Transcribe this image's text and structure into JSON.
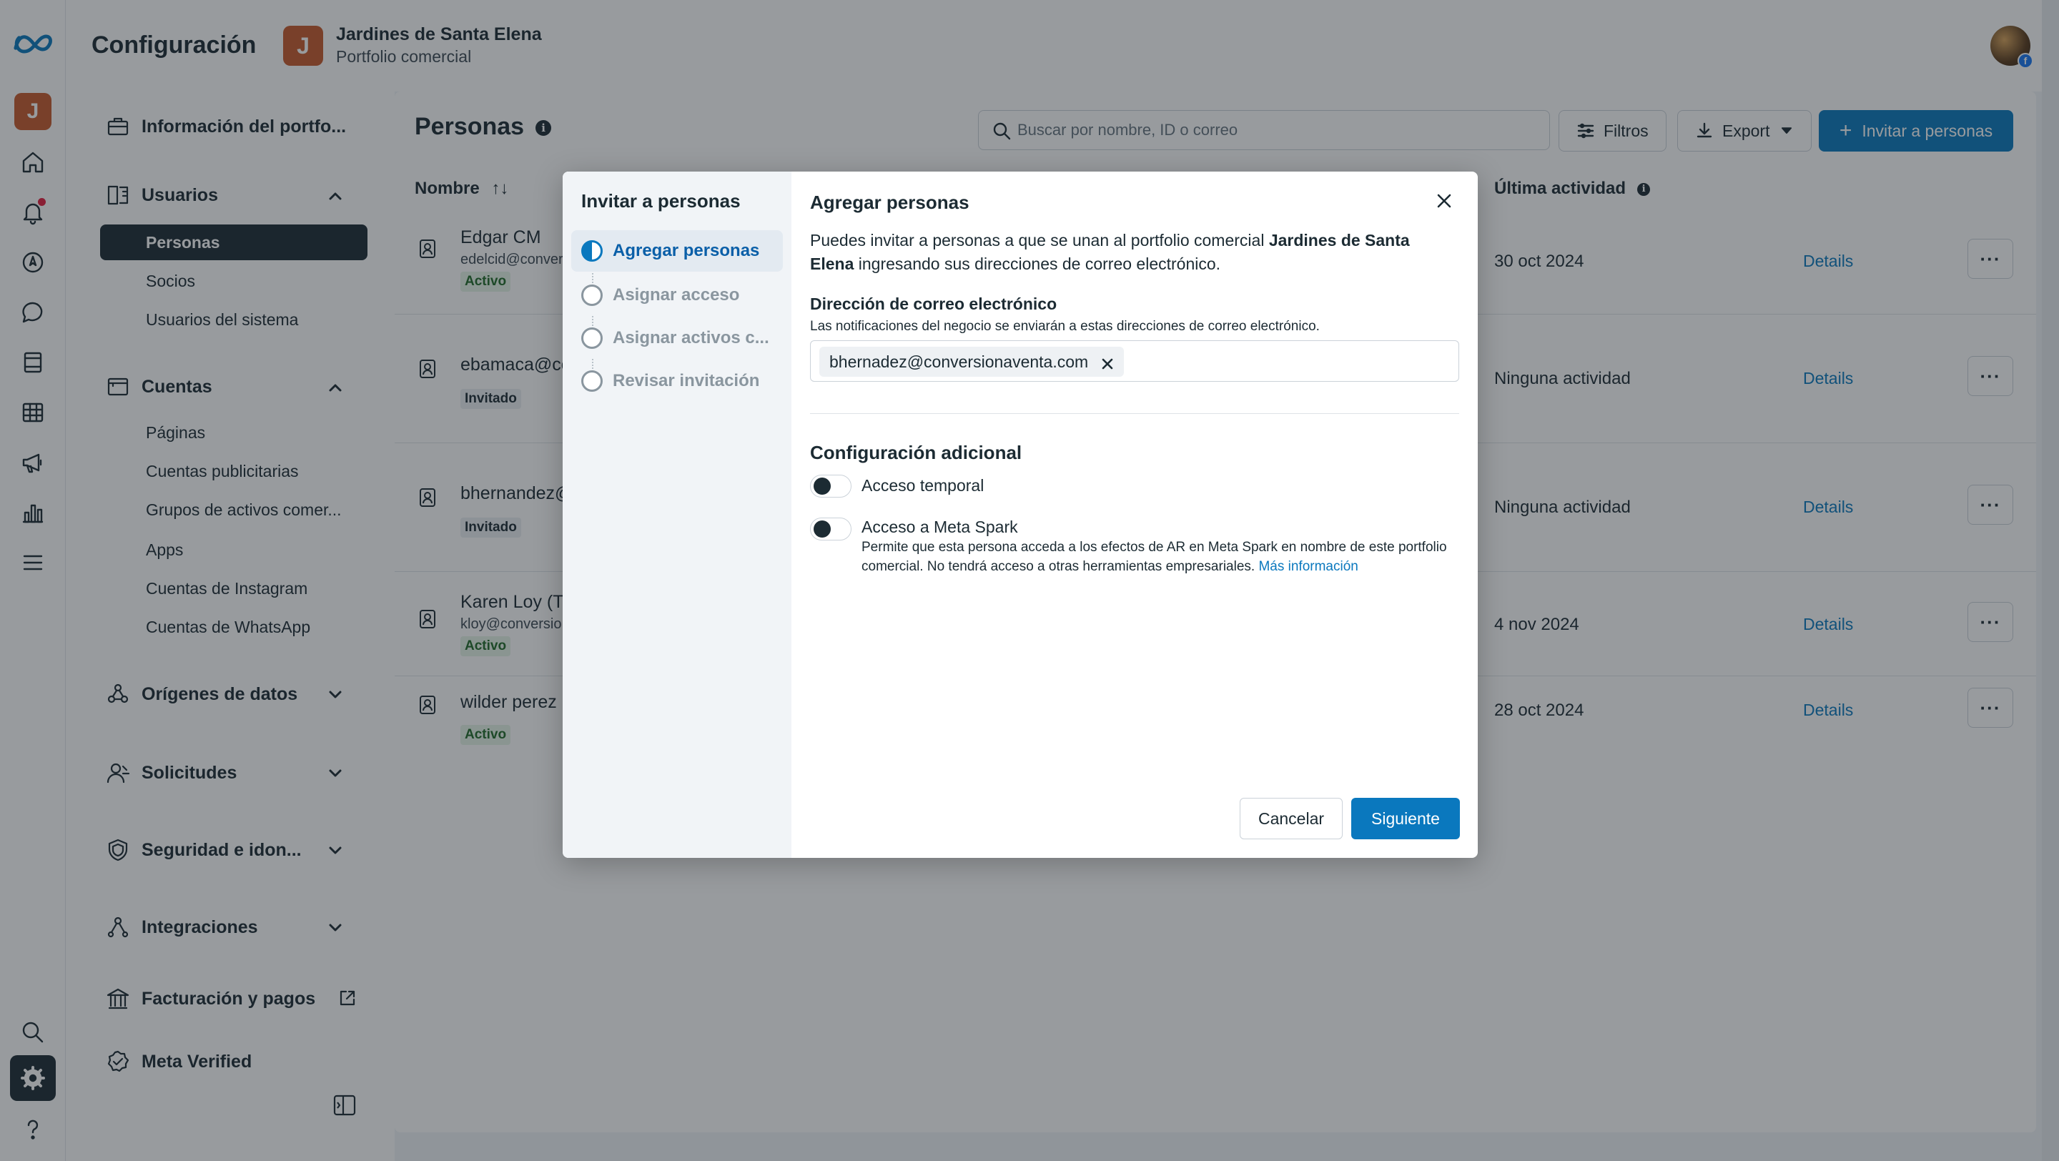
{
  "header": {
    "title": "Configuración",
    "business_initial": "J",
    "business_name": "Jardines de Santa Elena",
    "business_type": "Portfolio comercial"
  },
  "rail": {
    "avatar_initial": "J",
    "icons": [
      "meta-logo-icon",
      "home-icon",
      "bell-icon",
      "compass-icon",
      "chat-icon",
      "pages-icon",
      "table-icon",
      "megaphone-icon",
      "bar-chart-icon",
      "menu-icon",
      "search-icon",
      "gear-icon",
      "help-icon"
    ]
  },
  "sidebar": {
    "portfolio_info": "Información del portfo...",
    "users": {
      "label": "Usuarios",
      "items": [
        "Personas",
        "Socios",
        "Usuarios del sistema"
      ]
    },
    "accounts": {
      "label": "Cuentas",
      "items": [
        "Páginas",
        "Cuentas publicitarias",
        "Grupos de activos comer...",
        "Apps",
        "Cuentas de Instagram",
        "Cuentas de WhatsApp"
      ]
    },
    "data_sources": "Orígenes de datos",
    "requests": "Solicitudes",
    "security": "Seguridad e idon...",
    "integrations": "Integraciones",
    "billing": "Facturación y pagos",
    "meta_verified": "Meta Verified"
  },
  "main": {
    "title": "Personas",
    "search_placeholder": "Buscar por nombre, ID o correo",
    "filters_label": "Filtros",
    "export_label": "Export",
    "invite_label": "Invitar a personas",
    "col_name": "Nombre",
    "col_activity": "Última actividad",
    "rows": [
      {
        "name": "Edgar CM",
        "email": "edelcid@conver",
        "status": "Activo",
        "activity": "30 oct 2024",
        "details": "Details"
      },
      {
        "name": "ebamaca@cc",
        "email": "",
        "status": "Invitado",
        "activity": "Ninguna actividad",
        "details": "Details"
      },
      {
        "name": "bhernandez@",
        "email": "",
        "status": "Invitado",
        "activity": "Ninguna actividad",
        "details": "Details"
      },
      {
        "name": "Karen Loy (T",
        "email": "kloy@conversio",
        "status": "Activo",
        "activity": "4 nov 2024",
        "details": "Details"
      },
      {
        "name": "wilder perez",
        "email": "",
        "status": "Activo",
        "activity": "28 oct 2024",
        "details": "Details"
      }
    ],
    "more_label": "···"
  },
  "modal": {
    "steps_title": "Invitar a personas",
    "steps": [
      "Agregar personas",
      "Asignar acceso",
      "Asignar activos c...",
      "Revisar invitación"
    ],
    "title": "Agregar personas",
    "desc_before": "Puedes invitar a personas a que se unan al portfolio comercial ",
    "desc_bold": "Jardines de Santa Elena",
    "desc_after": " ingresando sus direcciones de correo electrónico.",
    "email_label": "Dirección de correo electrónico",
    "email_help": "Las notificaciones del negocio se enviarán a estas direcciones de correo electrónico.",
    "email_chip": "bhernadez@conversionaventa.com",
    "additional_title": "Configuración adicional",
    "temp_access_label": "Acceso temporal",
    "spark_label": "Acceso a Meta Spark",
    "spark_desc": "Permite que esta persona acceda a los efectos de AR en Meta Spark en nombre de este portfolio comercial. No tendrá acceso a otras herramientas empresariales. ",
    "spark_more": "Más información",
    "cancel_label": "Cancelar",
    "next_label": "Siguiente"
  },
  "colors": {
    "accent": "#0a78be",
    "brand_orange": "#c65a2c",
    "active_badge_bg": "#e6f4e7",
    "dark": "#1c2b33"
  }
}
